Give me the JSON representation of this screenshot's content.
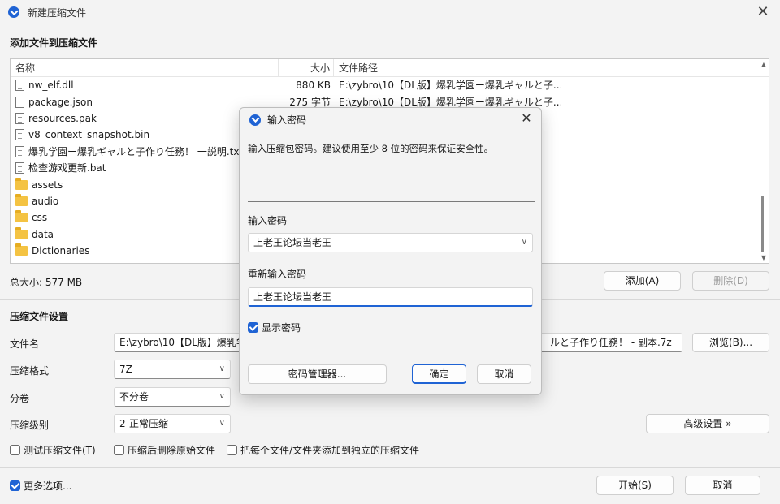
{
  "window": {
    "title": "新建压缩文件"
  },
  "add_section": {
    "title": "添加文件到压缩文件"
  },
  "filelist": {
    "columns": {
      "name": "名称",
      "size": "大小",
      "path": "文件路径"
    },
    "rows": [
      {
        "icon": "dll-file-icon",
        "name": "nw_elf.dll",
        "size": "880 KB",
        "path": "E:\\zybro\\10【DL版】爆乳学園ー爆乳ギャルと子..."
      },
      {
        "icon": "json-file-icon",
        "name": "package.json",
        "size": "275 字节",
        "path": "E:\\zybro\\10【DL版】爆乳学園ー爆乳ギャルと子..."
      },
      {
        "icon": "pak-file-icon",
        "name": "resources.pak",
        "size": "",
        "path": ""
      },
      {
        "icon": "bin-file-icon",
        "name": "v8_context_snapshot.bin",
        "size": "",
        "path": ""
      },
      {
        "icon": "txt-file-icon",
        "name": "爆乳学園ー爆乳ギャルと子作り任務！ 一説明.txt",
        "size": "",
        "path": ""
      },
      {
        "icon": "bat-file-icon",
        "name": "检查游戏更新.bat",
        "size": "",
        "path": ""
      },
      {
        "icon": "folder-icon",
        "name": "assets",
        "size": "",
        "path": ""
      },
      {
        "icon": "folder-icon",
        "name": "audio",
        "size": "",
        "path": ""
      },
      {
        "icon": "folder-icon",
        "name": "css",
        "size": "",
        "path": ""
      },
      {
        "icon": "folder-icon",
        "name": "data",
        "size": "",
        "path": ""
      },
      {
        "icon": "folder-icon",
        "name": "Dictionaries",
        "size": "",
        "path": ""
      }
    ]
  },
  "total_size": "总大小: 577 MB",
  "buttons": {
    "add": "添加(A)",
    "delete": "删除(D)",
    "browse": "浏览(B)...",
    "advanced": "高级设置 »",
    "start": "开始(S)",
    "cancel": "取消"
  },
  "settings": {
    "title": "压缩文件设置",
    "filename_label": "文件名",
    "filename_value_left": "E:\\zybro\\10【DL版】爆乳学",
    "filename_value_right": "ルと子作り任務！ - 副本.7z",
    "format_label": "压缩格式",
    "format_value": "7Z",
    "volume_label": "分卷",
    "volume_value": "不分卷",
    "level_label": "压缩级别",
    "level_value": "2-正常压缩"
  },
  "checkboxes": {
    "test": "测试压缩文件(T)",
    "delete_after": "压缩后删除原始文件",
    "separate": "把每个文件/文件夹添加到独立的压缩文件",
    "more_options": "更多选项..."
  },
  "dialog": {
    "title": "输入密码",
    "description": "输入压缩包密码。建议使用至少 8 位的密码来保证安全性。",
    "password_label": "输入密码",
    "password_value": "上老王论坛当老王",
    "confirm_label": "重新输入密码",
    "confirm_value": "上老王论坛当老王",
    "show_password": "显示密码",
    "manager_button": "密码管理器...",
    "ok_button": "确定",
    "cancel_button": "取消"
  }
}
